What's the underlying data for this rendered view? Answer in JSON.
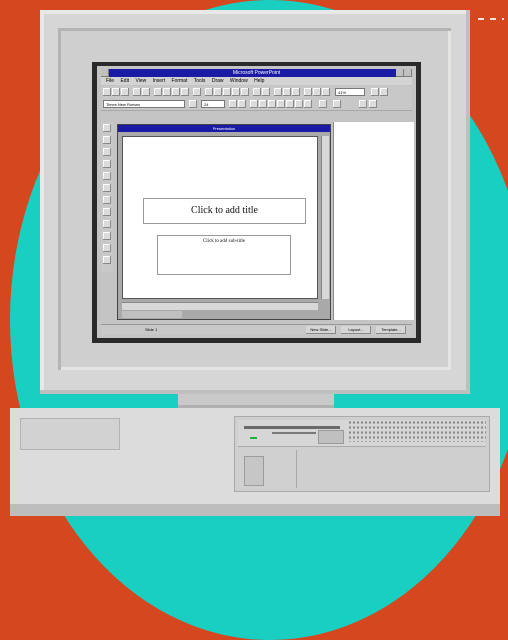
{
  "app": {
    "title": "Microsoft PowerPoint"
  },
  "menu": [
    "File",
    "Edit",
    "View",
    "Insert",
    "Format",
    "Tools",
    "Draw",
    "Window",
    "Help"
  ],
  "toolbar": {
    "font": "Times New Roman",
    "size": "24",
    "zoom": "41%"
  },
  "presentation": {
    "title": "Presentation",
    "title_placeholder": "Click to add title",
    "subtitle_placeholder": "Click to add sub-title"
  },
  "status": {
    "slide": "Slide 1",
    "new_slide": "New Slide...",
    "layout": "Layout...",
    "template": "Template..."
  },
  "colors": {
    "background": "#d5481f",
    "circle": "#19cfc2",
    "titlebar": "#1a1aa5",
    "led": "#1cb33a"
  }
}
